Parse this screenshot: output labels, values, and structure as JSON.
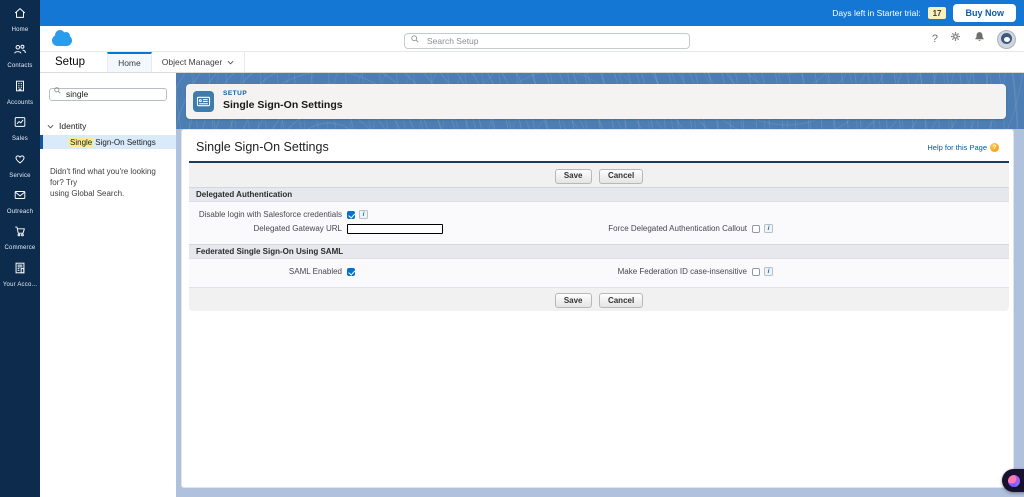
{
  "colors": {
    "rail_navy": "#0c2b4d",
    "topbar_blue": "#1477d4",
    "accent_blue": "#0176d3",
    "link_blue": "#015ba7",
    "texture_blue": "#4d7eb3",
    "page_background": "#b0c1dd",
    "highlight_yellow": "#ffe98c",
    "badge_yellow": "#fbf0bb",
    "section_header_bg": "#e7e7ee"
  },
  "app_rail": {
    "items": [
      {
        "label": "Home",
        "icon": "home-icon"
      },
      {
        "label": "Contacts",
        "icon": "contacts-icon"
      },
      {
        "label": "Accounts",
        "icon": "accounts-icon"
      },
      {
        "label": "Sales",
        "icon": "sales-icon"
      },
      {
        "label": "Service",
        "icon": "service-icon"
      },
      {
        "label": "Outreach",
        "icon": "outreach-icon"
      },
      {
        "label": "Commerce",
        "icon": "commerce-icon"
      },
      {
        "label": "Your Acco...",
        "icon": "your-account-icon"
      }
    ]
  },
  "trial_bar": {
    "days_label": "Days left in Starter trial:",
    "days_count": "17",
    "buy_now_label": "Buy Now"
  },
  "global_header": {
    "search_placeholder": "Search Setup",
    "help_glyph": "?"
  },
  "nav_tabs": {
    "app_label": "Setup",
    "tabs": [
      {
        "label": "Home",
        "active": true
      },
      {
        "label": "Object Manager",
        "active": false
      }
    ]
  },
  "setup_menu": {
    "search_value": "single",
    "group_label": "Identity",
    "selected_item": {
      "highlight": "Single",
      "rest": "Sign-On Settings"
    },
    "not_found_line1": "Didn't find what you're looking for? Try",
    "not_found_line2": "using Global Search."
  },
  "content_header": {
    "eyebrow": "SETUP",
    "title": "Single Sign-On Settings"
  },
  "page": {
    "title": "Single Sign-On Settings",
    "help_link": "Help for this Page",
    "help_glyph": "?",
    "info_glyph": "i",
    "buttons": {
      "save": "Save",
      "cancel": "Cancel"
    },
    "sections": [
      {
        "title": "Delegated Authentication",
        "fields": [
          {
            "label": "Disable login with Salesforce credentials",
            "type": "checkbox",
            "checked": true
          },
          {
            "label": "Delegated Gateway URL",
            "type": "text",
            "value": ""
          },
          {
            "label": "Force Delegated Authentication Callout",
            "type": "checkbox",
            "checked": false
          }
        ]
      },
      {
        "title": "Federated Single Sign-On Using SAML",
        "fields": [
          {
            "label": "SAML Enabled",
            "type": "checkbox",
            "checked": true
          },
          {
            "label": "Make Federation ID case-insensitive",
            "type": "checkbox",
            "checked": false
          }
        ]
      }
    ]
  }
}
